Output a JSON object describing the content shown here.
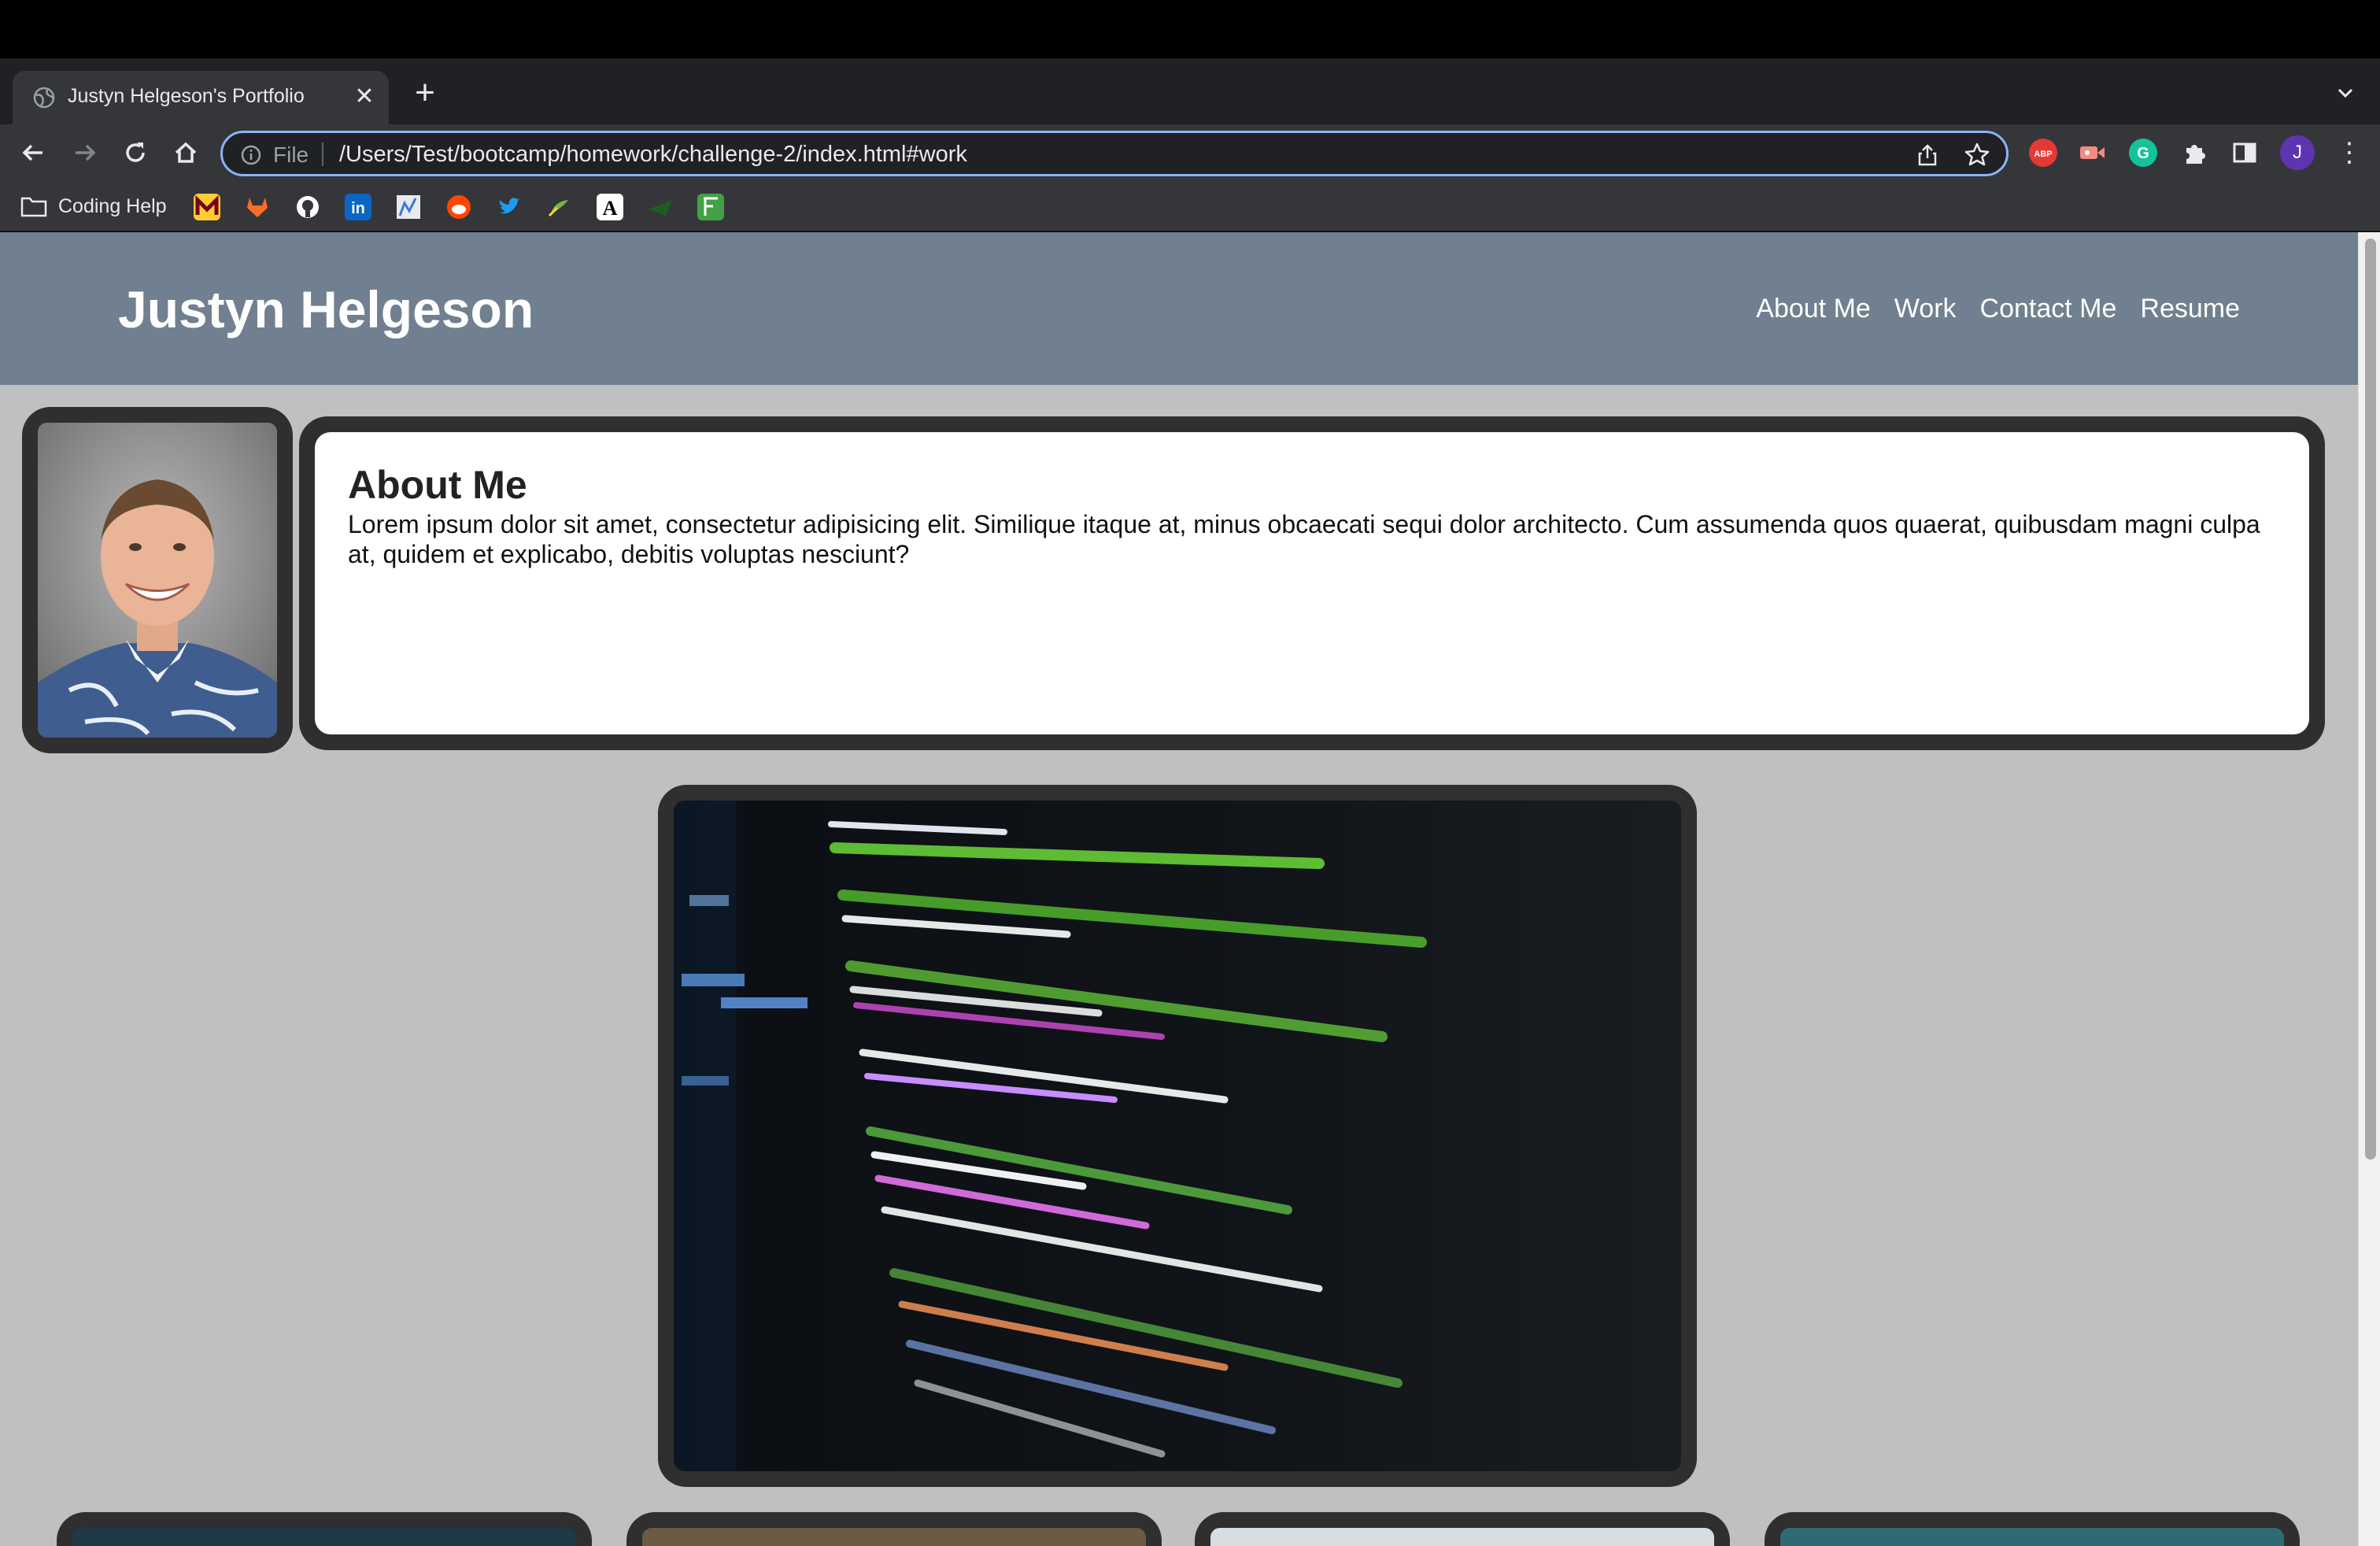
{
  "browser": {
    "tab_title": "Justyn Helgeson's Portfolio",
    "url_scheme": "File",
    "url": "/Users/Test/bootcamp/homework/challenge-2/index.html#work",
    "profile_initial": "J",
    "bookmarks": {
      "folder_label": "Coding Help",
      "icons": [
        "umn-icon",
        "gitlab-icon",
        "github-icon",
        "linkedin-icon",
        "chart-icon",
        "reddit-icon",
        "twitter-icon",
        "leaf-icon",
        "a-icon",
        "paper-plane-icon",
        "calc-icon"
      ]
    },
    "extensions": [
      "adblock-icon",
      "video-icon",
      "grammarly-icon",
      "puzzle-icon",
      "sidepanel-icon"
    ]
  },
  "site": {
    "title": "Justyn Helgeson",
    "nav": [
      "About Me",
      "Work",
      "Contact Me",
      "Resume"
    ],
    "about": {
      "heading": "About Me",
      "body": "Lorem ipsum dolor sit amet, consectetur adipisicing elit. Similique itaque at, minus obcaecati sequi dolor architecto. Cum assumenda quos quaerat, quibusdam magni culpa at, quidem et explicabo, debitis voluptas nesciunt?"
    }
  },
  "colors": {
    "header_bg": "#708090",
    "page_bg": "#c0c0c0",
    "frame": "#2f2f2f",
    "omnibox_focus": "#8ab4f8"
  }
}
